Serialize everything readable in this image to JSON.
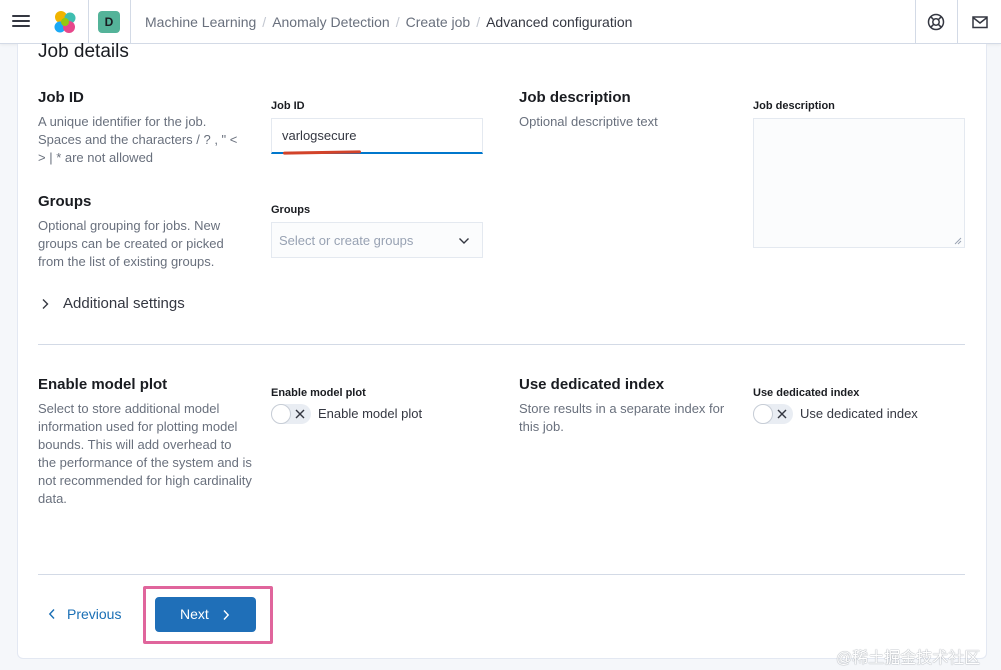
{
  "header": {
    "space_initial": "D",
    "breadcrumbs": [
      "Machine Learning",
      "Anomaly Detection",
      "Create job",
      "Advanced configuration"
    ],
    "icons": [
      "menu-icon",
      "elastic-logo",
      "help-icon",
      "mail-icon"
    ]
  },
  "job_details": {
    "section_title": "Job details",
    "job_id": {
      "title": "Job ID",
      "description": "A unique identifier for the job. Spaces and the characters / ? , \" < > | * are not allowed",
      "field_label": "Job ID",
      "value": "varlogsecure"
    },
    "groups": {
      "title": "Groups",
      "description": "Optional grouping for jobs. New groups can be created or picked from the list of existing groups.",
      "field_label": "Groups",
      "placeholder": "Select or create groups"
    },
    "job_description": {
      "title": "Job description",
      "description": "Optional descriptive text",
      "field_label": "Job description",
      "value": ""
    },
    "additional_settings_label": "Additional settings"
  },
  "model_plot": {
    "title": "Enable model plot",
    "description": "Select to store additional model information used for plotting model bounds. This will add overhead to the performance of the system and is not recommended for high cardinality data.",
    "field_label": "Enable model plot",
    "switch_label": "Enable model plot",
    "enabled": false
  },
  "dedicated_index": {
    "title": "Use dedicated index",
    "description": "Store results in a separate index for this job.",
    "field_label": "Use dedicated index",
    "switch_label": "Use dedicated index",
    "enabled": false
  },
  "footer": {
    "previous_label": "Previous",
    "next_label": "Next"
  },
  "watermark": "@稀土掘金技术社区",
  "colors": {
    "primary": "#1f6fb8",
    "link": "#1a6fb5",
    "highlight": "#e0659c",
    "input_focus": "#0077cc"
  }
}
